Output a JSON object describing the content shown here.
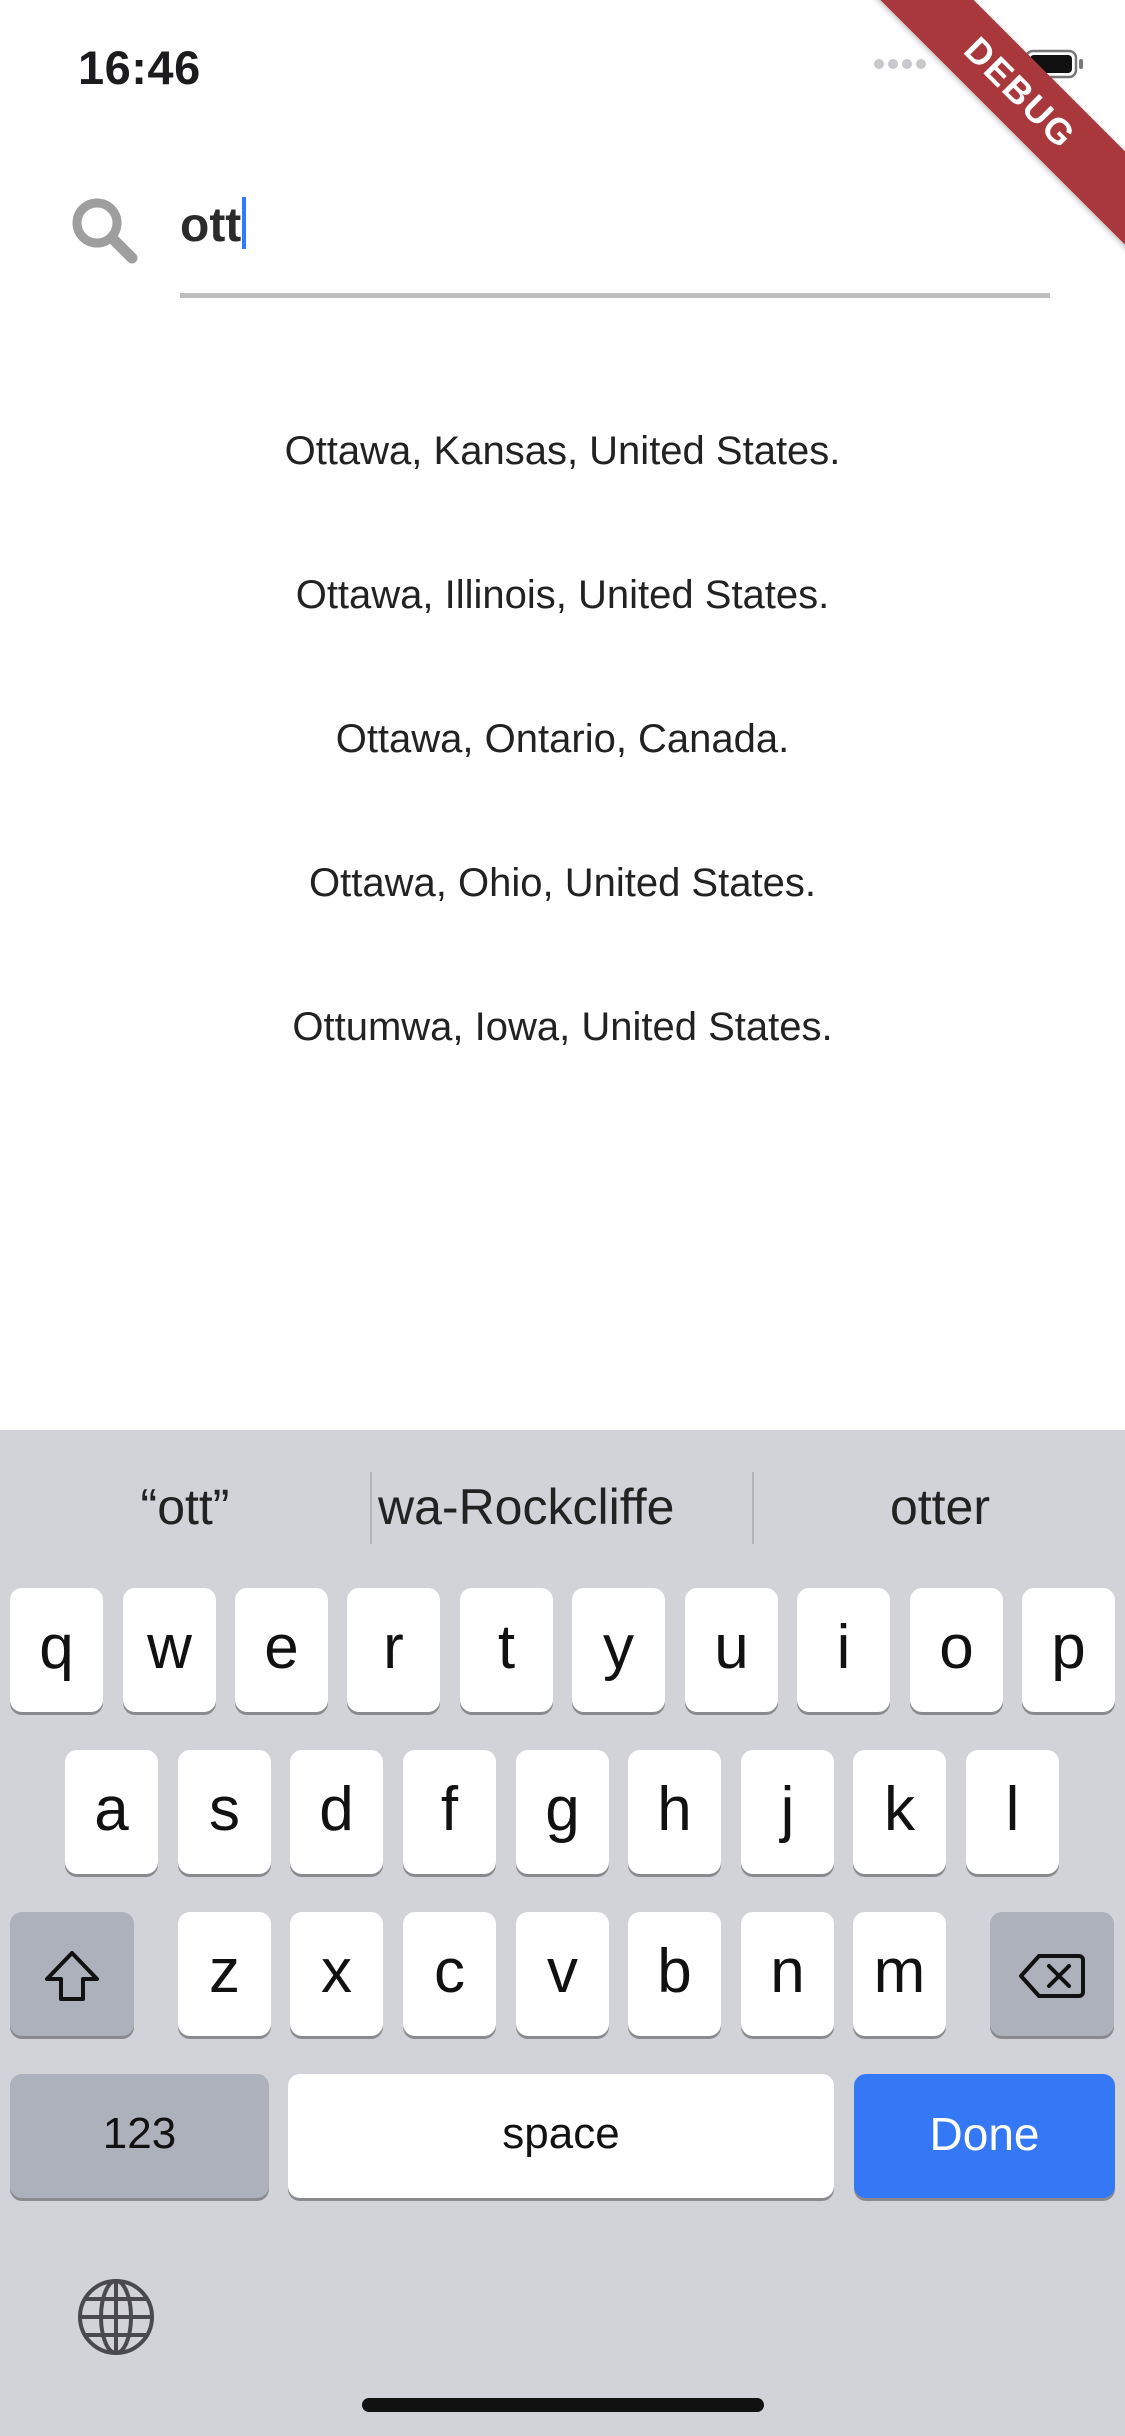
{
  "status_bar": {
    "time": "16:46",
    "banner": "DEBUG"
  },
  "search": {
    "value": "ott"
  },
  "results": [
    "Ottawa, Kansas, United States.",
    "Ottawa, Illinois, United States.",
    "Ottawa, Ontario, Canada.",
    "Ottawa, Ohio, United States.",
    "Ottumwa, Iowa, United States."
  ],
  "keyboard": {
    "suggestions": [
      "“ott”",
      "wa-Rockcliffe",
      "otter"
    ],
    "row1": [
      "q",
      "w",
      "e",
      "r",
      "t",
      "y",
      "u",
      "i",
      "o",
      "p"
    ],
    "row2": [
      "a",
      "s",
      "d",
      "f",
      "g",
      "h",
      "j",
      "k",
      "l"
    ],
    "row3": [
      "z",
      "x",
      "c",
      "v",
      "b",
      "n",
      "m"
    ],
    "numbers_label": "123",
    "space_label": "space",
    "done_label": "Done"
  },
  "colors": {
    "accent": "#3478f6",
    "keyboard_bg": "#d2d3d9",
    "debug": "#a8383b"
  }
}
